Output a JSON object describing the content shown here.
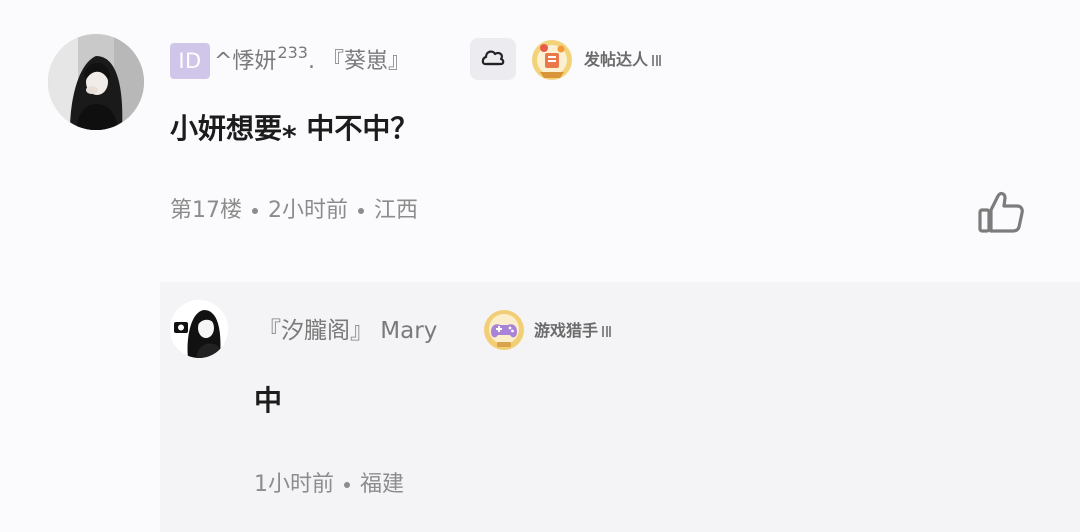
{
  "comment": {
    "user": {
      "id_badge": "ID",
      "name": "^悸妍",
      "name_sup": "233",
      "name_tail": ". 『葵崽』",
      "medal_label": "发帖达人"
    },
    "text": "小妍想要⁎ 中不中？",
    "floor": "第17楼",
    "time": "2小时前",
    "location": "江西",
    "icons": {
      "level": "bun-icon",
      "medal": "poster-medal-icon",
      "like": "thumbs-up-icon"
    }
  },
  "reply": {
    "user": {
      "name": "『汐朧阁』 Mary",
      "medal_label": "游戏猎手"
    },
    "text": "中",
    "time": "1小时前",
    "location": "福建",
    "icons": {
      "medal": "gamepad-medal-icon"
    }
  },
  "colors": {
    "background": "#fbfbfd",
    "reply_background": "#f4f4f7",
    "id_badge": "#cfc6ea",
    "muted_text": "#8c8c8c"
  }
}
